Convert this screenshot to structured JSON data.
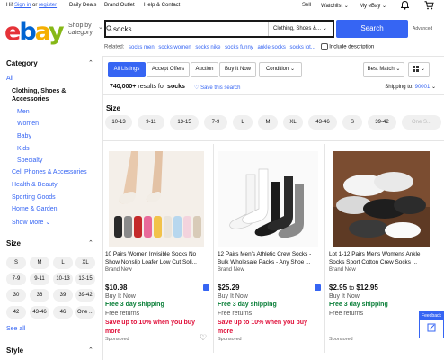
{
  "topbar": {
    "greeting": "Hi!",
    "sign_in": "Sign in",
    "or": "or",
    "register": "register",
    "daily_deals": "Daily Deals",
    "brand_outlet": "Brand Outlet",
    "help_contact": "Help & Contact",
    "sell": "Sell",
    "watchlist": "Watchlist",
    "my_ebay": "My eBay"
  },
  "header": {
    "logo": [
      "e",
      "b",
      "a",
      "y"
    ],
    "shop_by_category": "Shop by category",
    "search_value": "socks",
    "category_select": "Clothing, Shoes &...",
    "search_button": "Search",
    "advanced": "Advanced"
  },
  "related": {
    "label": "Related:",
    "items": [
      "socks men",
      "socks women",
      "socks nike",
      "socks funny",
      "ankle socks",
      "socks lot..."
    ],
    "include_description": "Include description"
  },
  "sidebar": {
    "category_heading": "Category",
    "all": "All",
    "current": "Clothing, Shoes & Accessories",
    "sub_items": [
      "Men",
      "Women",
      "Baby",
      "Kids",
      "Specialty"
    ],
    "other_categories": [
      "Cell Phones & Accessories",
      "Health & Beauty",
      "Sporting Goods",
      "Home & Garden"
    ],
    "show_more": "Show More",
    "size_heading": "Size",
    "sizes": [
      "S",
      "M",
      "L",
      "XL",
      "7-9",
      "9-11",
      "10-13",
      "13-15",
      "30",
      "36",
      "39",
      "39-42",
      "42",
      "43-46",
      "46",
      "One ..."
    ],
    "see_all": "See all",
    "style_heading": "Style"
  },
  "filters": {
    "tabs": [
      "All Listings",
      "Accept Offers",
      "Auction",
      "Buy It Now",
      "Condition"
    ],
    "sort": "Best Match",
    "results_count": "740,000+",
    "results_for": "results for",
    "query": "socks",
    "save_search": "Save this search",
    "ship_to_label": "Shipping to:",
    "ship_to_zip": "90001"
  },
  "size_filter": {
    "heading": "Size",
    "chips": [
      "10-13",
      "9-11",
      "13-15",
      "7-9",
      "L",
      "M",
      "XL",
      "43-46",
      "S",
      "39-42",
      "One S..."
    ]
  },
  "listings": [
    {
      "title": "10 Pairs Women Invisible Socks No Show Nonslip Loafer Low Cut Soli...",
      "condition": "Brand New",
      "price": "$10.98",
      "buy_it_now": "Buy It Now",
      "shipping": "Free 3 day shipping",
      "returns": "Free returns",
      "savings": "Save up to 10% when you buy more",
      "sponsored": "Sponsored"
    },
    {
      "title": "12 Pairs Men's Athletic Crew Socks - Bulk Wholesale Packs - Any Shoe ...",
      "condition": "Brand New",
      "price": "$25.29",
      "buy_it_now": "Buy It Now",
      "shipping": "Free 3 day shipping",
      "returns": "Free returns",
      "savings": "Save up to 10% when you buy more",
      "sponsored": "Sponsored"
    },
    {
      "title": "Lot 1-12 Pairs Mens Womens Ankle Socks Sport Cotton Crew Socks ...",
      "condition": "Brand New",
      "price_from": "$2.95",
      "price_to_word": "to",
      "price_to": "$12.95",
      "buy_it_now": "Buy It Now",
      "shipping": "Free 3 day shipping",
      "returns": "Free returns",
      "sponsored": "Sponsored"
    }
  ],
  "feedback": "Feedback",
  "colors": {
    "accent": "#3665f3",
    "green": "#067d35",
    "red": "#e0103a"
  }
}
